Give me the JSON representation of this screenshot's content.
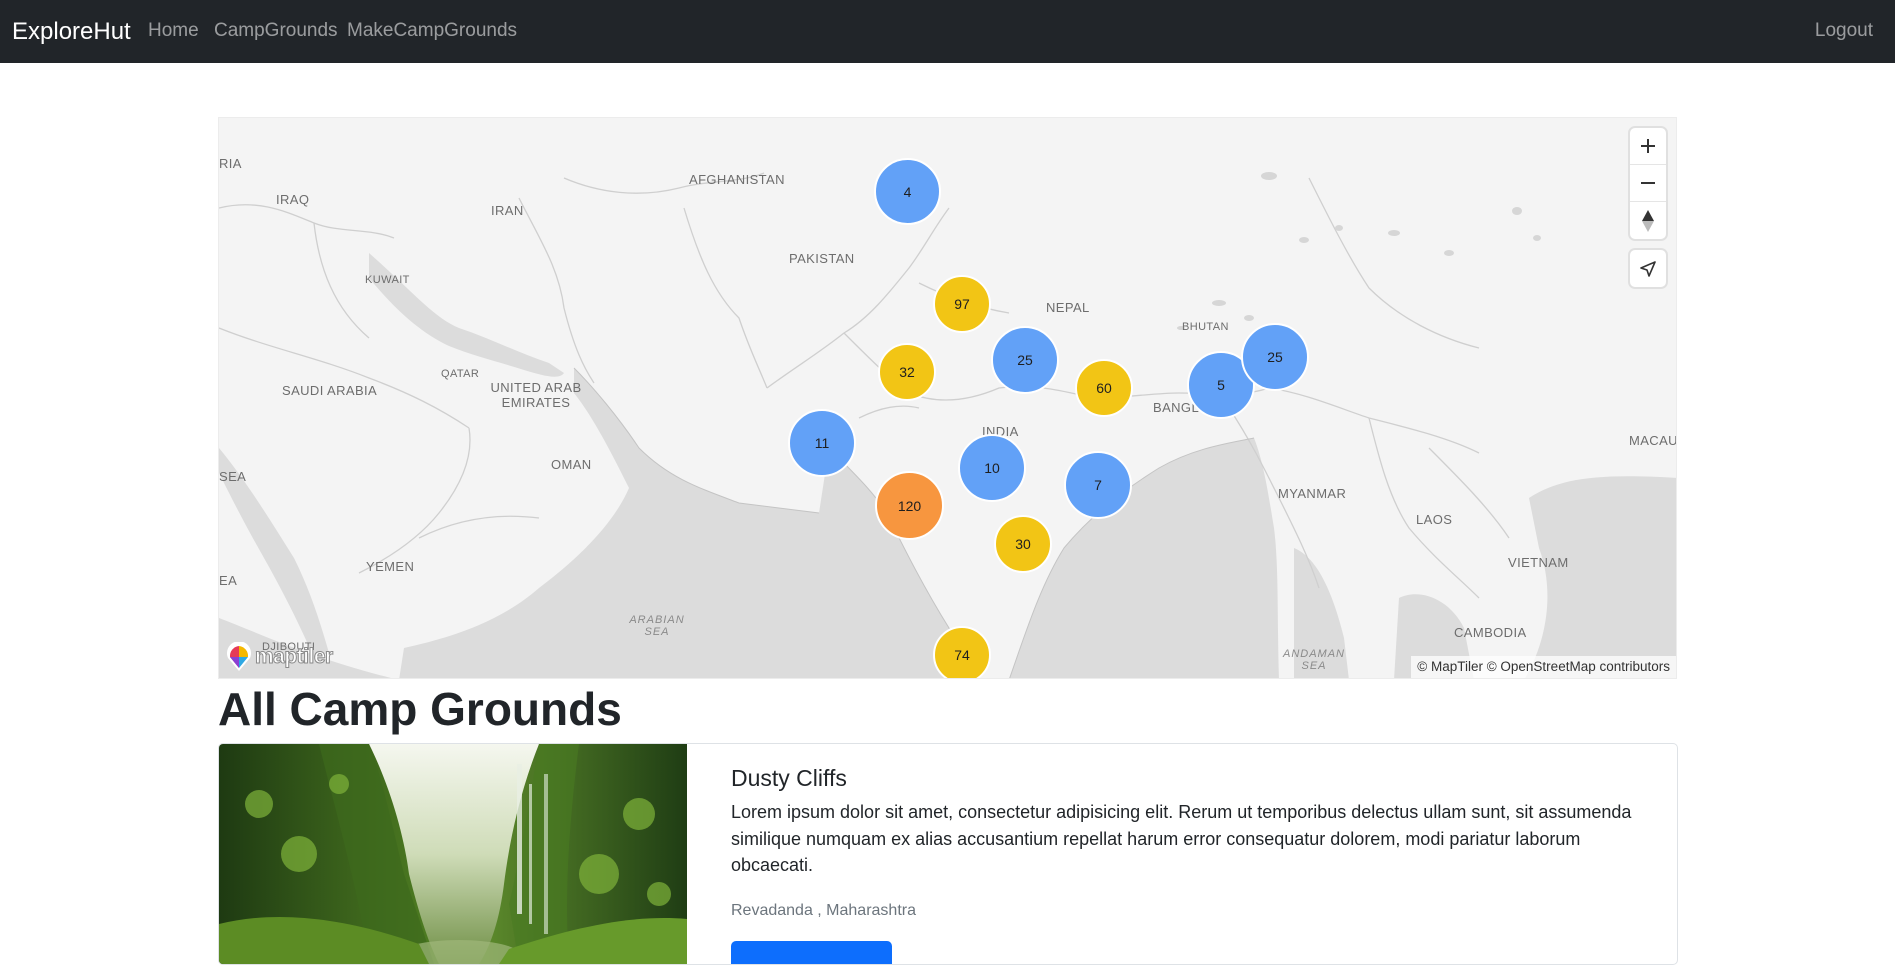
{
  "navbar": {
    "brand": "ExploreHut",
    "links": [
      "Home",
      "CampGrounds",
      "MakeCampGrounds"
    ],
    "logout": "Logout"
  },
  "map": {
    "countries": [
      "AFGHANISTAN",
      "PAKISTAN",
      "IRAQ",
      "IRAN",
      "KUWAIT",
      "QATAR",
      "UNITED ARAB EMIRATES",
      "SAUDI ARABIA",
      "OMAN",
      "YEMEN",
      "NEPAL",
      "BHUTAN",
      "BANGL",
      "INDIA",
      "MYANMAR",
      "LAOS",
      "VIETNAM",
      "CAMBODIA",
      "MACAU",
      "DJIBOUTI",
      "RIA",
      "SEA",
      "EA"
    ],
    "seas": [
      "ARABIAN SEA",
      "ANDAMAN SEA"
    ],
    "clusters": [
      {
        "count": "4",
        "color": "#62a1f7"
      },
      {
        "count": "97",
        "color": "#f2c515"
      },
      {
        "count": "32",
        "color": "#f2c515"
      },
      {
        "count": "25",
        "color": "#62a1f7"
      },
      {
        "count": "60",
        "color": "#f2c515"
      },
      {
        "count": "5",
        "color": "#62a1f7"
      },
      {
        "count": "25",
        "color": "#62a1f7"
      },
      {
        "count": "11",
        "color": "#62a1f7"
      },
      {
        "count": "10",
        "color": "#62a1f7"
      },
      {
        "count": "7",
        "color": "#62a1f7"
      },
      {
        "count": "120",
        "color": "#f7963f"
      },
      {
        "count": "30",
        "color": "#f2c515"
      },
      {
        "count": "74",
        "color": "#f2c515"
      }
    ],
    "controls": [
      "zoom-in-icon",
      "zoom-out-icon",
      "compass-icon",
      "geolocate-icon"
    ],
    "logo_text": "maptiler",
    "attribution": "© MapTiler © OpenStreetMap contributors"
  },
  "heading": "All Camp Grounds",
  "campground": {
    "title": "Dusty Cliffs",
    "description": "Lorem ipsum dolor sit amet, consectetur adipisicing elit. Rerum ut temporibus delectus ullam sunt, sit assumenda similique numquam ex alias accusantium repellat harum error consequatur dolorem, modi pariatur laborum obcaecati.",
    "location": "Revadanda , Maharashtra",
    "button": ""
  },
  "colors": {
    "navbar": "#212529",
    "primary": "#0d6efd",
    "cluster_small": "#62a1f7",
    "cluster_medium": "#f2c515",
    "cluster_large": "#f7963f"
  }
}
